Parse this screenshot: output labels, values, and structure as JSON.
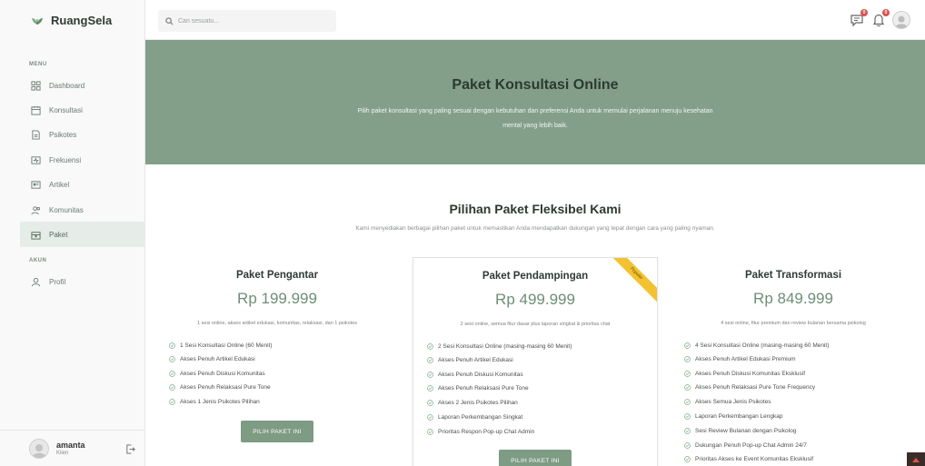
{
  "app": {
    "brand": "RuangSela"
  },
  "sidebar": {
    "menu_label": "MENU",
    "items": [
      {
        "label": "Dashboard",
        "icon": "dashboard-icon"
      },
      {
        "label": "Konsultasi",
        "icon": "calendar-icon"
      },
      {
        "label": "Psikotes",
        "icon": "document-icon"
      },
      {
        "label": "Frekuensi",
        "icon": "wave-icon"
      },
      {
        "label": "Artikel",
        "icon": "newspaper-icon"
      },
      {
        "label": "Komunitas",
        "icon": "users-icon"
      },
      {
        "label": "Paket",
        "icon": "package-icon",
        "active": true
      }
    ],
    "account_label": "AKUN",
    "account_items": [
      {
        "label": "Profil",
        "icon": "user-icon"
      }
    ],
    "user": {
      "name": "amanta",
      "role": "Klien"
    }
  },
  "topbar": {
    "search_placeholder": "Cari sesuatu...",
    "message_badge": "0",
    "notification_badge": "0"
  },
  "hero": {
    "title": "Paket Konsultasi Online",
    "subtitle": "Pilih paket konsultasi yang paling sesuai dengan kebutuhan dan preferensi Anda untuk memulai perjalanan menuju kesehatan mental yang lebih baik."
  },
  "plans_section": {
    "title": "Pilihan Paket Fleksibel Kami",
    "subtitle": "Kami menyediakan berbagai pilihan paket untuk memastikan Anda mendapatkan dukungan yang tepat dengan cara yang paling nyaman."
  },
  "plans": [
    {
      "name": "Paket Pengantar",
      "price": "Rp 199.999",
      "description": "1 sesi online, akses artikel edukasi, komunitas, relaksasi, dan 1 psikotes",
      "features": [
        "1 Sesi Konsultasi Online (60 Menit)",
        "Akses Penuh Artikel Edukasi",
        "Akses Penuh Diskusi Komunitas",
        "Akses Penuh Relaksasi Pure Tone",
        "Akses 1 Jenis Psikotes Pilihan"
      ],
      "button": "PILIH PAKET INI"
    },
    {
      "name": "Paket Pendampingan",
      "price": "Rp 499.999",
      "badge": "Populer",
      "description": "2 sesi online, semua fitur dasar plus laporan singkat & prioritas chat",
      "features": [
        "2 Sesi Konsultasi Online (masing-masing 60 Menit)",
        "Akses Penuh Artikel Edukasi",
        "Akses Penuh Diskusi Komunitas",
        "Akses Penuh Relaksasi Pure Tone",
        "Akses 2 Jenis Psikotes Pilihan",
        "Laporan Perkembangan Singkat",
        "Prioritas Respon Pop-up Chat Admin"
      ],
      "button": "PILIH PAKET INI"
    },
    {
      "name": "Paket Transformasi",
      "price": "Rp 849.999",
      "description": "4 sesi online, fitur premium dan review bulanan bersama psikolog",
      "features": [
        "4 Sesi Konsultasi Online (masing-masing 60 Menit)",
        "Akses Penuh Artikel Edukasi Premium",
        "Akses Penuh Diskusi Komunitas Eksklusif",
        "Akses Penuh Relaksasi Pure Tone Frequency",
        "Akses Semua Jenis Psikotes",
        "Laporan Perkembangan Lengkap",
        "Sesi Review Bulanan dengan Psikolog",
        "Dukungan Penuh Pop-up Chat Admin 24/7",
        "Prioritas Akses ke Event Komunitas Eksklusif"
      ]
    }
  ],
  "colors": {
    "primary": "#839f89",
    "button": "#7e9b84",
    "price": "#6f8e75",
    "badge": "#f2c232",
    "check": "#7fae88"
  }
}
